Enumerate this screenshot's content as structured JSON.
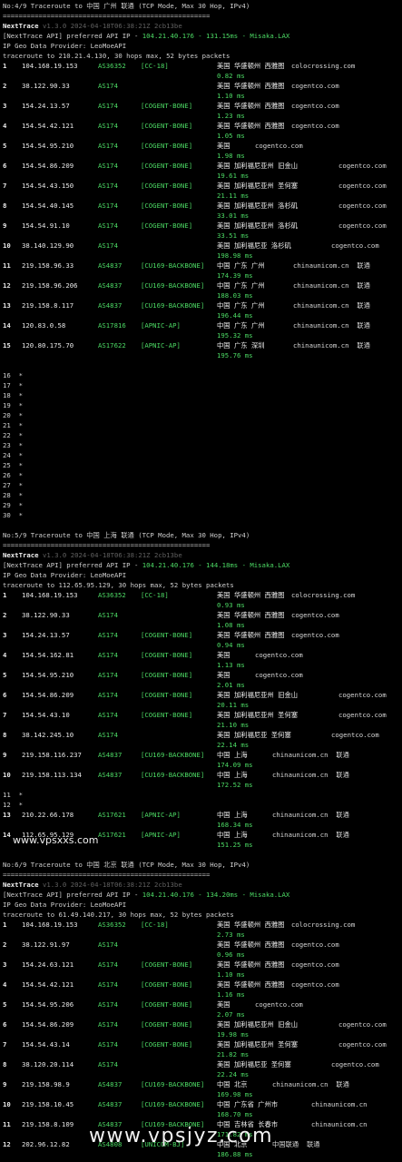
{
  "sections": [
    {
      "header": "No:4/9 Traceroute to 中国 广州 联通 (TCP Mode, Max 30 Hop, IPv4)",
      "separator": "====================================================",
      "app_name": "NextTrace",
      "version": "v1.3.0 2024-04-18T06:38:21Z 2cb13be",
      "api_prefix": "[NextTrace API] preferred API IP - ",
      "api_value": "104.21.40.176 - 131.15ms - Misaka.LAX",
      "geo_provider": "IP Geo Data Provider: LeoMoeAPI",
      "traceroute": "traceroute to 210.21.4.130, 30 hops max, 52 bytes packets",
      "hops": [
        {
          "n": "1",
          "ip": "104.168.19.153",
          "asn": "AS36352",
          "tag": "[CC-18]",
          "geo": "美国 华盛顿州 西雅图",
          "host": "colocrossing.com",
          "rtt": "0.82 ms"
        },
        {
          "n": "2",
          "ip": "38.122.90.33",
          "asn": "AS174",
          "tag": "",
          "geo": "美国 华盛顿州 西雅图",
          "host": "cogentco.com",
          "rtt": "1.10 ms"
        },
        {
          "n": "3",
          "ip": "154.24.13.57",
          "asn": "AS174",
          "tag": "[COGENT-BONE]",
          "geo": "美国 华盛顿州 西雅图",
          "host": "cogentco.com",
          "rtt": "1.23 ms"
        },
        {
          "n": "4",
          "ip": "154.54.42.121",
          "asn": "AS174",
          "tag": "[COGENT-BONE]",
          "geo": "美国 华盛顿州 西雅图",
          "host": "cogentco.com",
          "rtt": "1.05 ms"
        },
        {
          "n": "5",
          "ip": "154.54.95.210",
          "asn": "AS174",
          "tag": "[COGENT-BONE]",
          "geo": "美国",
          "host": "cogentco.com",
          "rtt": "1.98 ms"
        },
        {
          "n": "6",
          "ip": "154.54.86.209",
          "asn": "AS174",
          "tag": "[COGENT-BONE]",
          "geo": "美国 加利福尼亚州 旧金山",
          "host": "cogentco.com",
          "rtt": "19.61 ms"
        },
        {
          "n": "7",
          "ip": "154.54.43.150",
          "asn": "AS174",
          "tag": "[COGENT-BONE]",
          "geo": "美国 加利福尼亚州 圣何塞",
          "host": "cogentco.com",
          "rtt": "21.11 ms"
        },
        {
          "n": "8",
          "ip": "154.54.40.145",
          "asn": "AS174",
          "tag": "[COGENT-BONE]",
          "geo": "美国 加利福尼亚州 洛杉矶",
          "host": "cogentco.com",
          "rtt": "33.01 ms"
        },
        {
          "n": "9",
          "ip": "154.54.91.10",
          "asn": "AS174",
          "tag": "[COGENT-BONE]",
          "geo": "美国 加利福尼亚州 洛杉矶",
          "host": "cogentco.com",
          "rtt": "33.51 ms"
        },
        {
          "n": "10",
          "ip": "38.140.129.90",
          "asn": "AS174",
          "tag": "",
          "geo": "美国 加利福尼亚 洛杉矶",
          "host": "cogentco.com",
          "rtt": "198.98 ms"
        },
        {
          "n": "11",
          "ip": "219.158.96.33",
          "asn": "AS4837",
          "tag": "[CU169-BACKBONE]",
          "geo": "中国 广东 广州",
          "host": "chinaunicom.cn  联通",
          "rtt": "174.39 ms"
        },
        {
          "n": "12",
          "ip": "219.158.96.206",
          "asn": "AS4837",
          "tag": "[CU169-BACKBONE]",
          "geo": "中国 广东 广州",
          "host": "chinaunicom.cn  联通",
          "rtt": "188.03 ms"
        },
        {
          "n": "13",
          "ip": "219.158.8.117",
          "asn": "AS4837",
          "tag": "[CU169-BACKBONE]",
          "geo": "中国 广东 广州",
          "host": "chinaunicom.cn  联通",
          "rtt": "196.44 ms"
        },
        {
          "n": "14",
          "ip": "120.83.0.58",
          "asn": "AS17816",
          "tag": "[APNIC-AP]",
          "geo": "中国 广东 广州",
          "host": "chinaunicom.cn  联通",
          "rtt": "195.32 ms"
        },
        {
          "n": "15",
          "ip": "120.80.175.70",
          "asn": "AS17622",
          "tag": "[APNIC-AP]",
          "geo": "中国 广东 深圳",
          "host": "chinaunicom.cn  联通",
          "rtt": "195.76 ms"
        }
      ],
      "stars": [
        "16",
        "17",
        "18",
        "19",
        "20",
        "21",
        "22",
        "23",
        "24",
        "25",
        "26",
        "27",
        "28",
        "29",
        "30"
      ]
    },
    {
      "header": "No:5/9 Traceroute to 中国 上海 联通 (TCP Mode, Max 30 Hop, IPv4)",
      "separator": "====================================================",
      "app_name": "NextTrace",
      "version": "v1.3.0 2024-04-18T06:38:21Z 2cb13be",
      "api_prefix": "[NextTrace API] preferred API IP - ",
      "api_value": "104.21.40.176 - 144.18ms - Misaka.LAX",
      "geo_provider": "IP Geo Data Provider: LeoMoeAPI",
      "traceroute": "traceroute to 112.65.95.129, 30 hops max, 52 bytes packets",
      "hops": [
        {
          "n": "1",
          "ip": "104.168.19.153",
          "asn": "AS36352",
          "tag": "[CC-18]",
          "geo": "美国 华盛顿州 西雅图",
          "host": "colocrossing.com",
          "rtt": "0.93 ms"
        },
        {
          "n": "2",
          "ip": "38.122.90.33",
          "asn": "AS174",
          "tag": "",
          "geo": "美国 华盛顿州 西雅图",
          "host": "cogentco.com",
          "rtt": "1.08 ms"
        },
        {
          "n": "3",
          "ip": "154.24.13.57",
          "asn": "AS174",
          "tag": "[COGENT-BONE]",
          "geo": "美国 华盛顿州 西雅图",
          "host": "cogentco.com",
          "rtt": "0.94 ms"
        },
        {
          "n": "4",
          "ip": "154.54.162.81",
          "asn": "AS174",
          "tag": "[COGENT-BONE]",
          "geo": "美国",
          "host": "cogentco.com",
          "rtt": "1.13 ms"
        },
        {
          "n": "5",
          "ip": "154.54.95.210",
          "asn": "AS174",
          "tag": "[COGENT-BONE]",
          "geo": "美国",
          "host": "cogentco.com",
          "rtt": "2.01 ms"
        },
        {
          "n": "6",
          "ip": "154.54.86.209",
          "asn": "AS174",
          "tag": "[COGENT-BONE]",
          "geo": "美国 加利福尼亚州 旧金山",
          "host": "cogentco.com",
          "rtt": "20.11 ms"
        },
        {
          "n": "7",
          "ip": "154.54.43.10",
          "asn": "AS174",
          "tag": "[COGENT-BONE]",
          "geo": "美国 加利福尼亚州 圣何塞",
          "host": "cogentco.com",
          "rtt": "21.10 ms"
        },
        {
          "n": "8",
          "ip": "38.142.245.10",
          "asn": "AS174",
          "tag": "",
          "geo": "美国 加利福尼亚 圣何塞",
          "host": "cogentco.com",
          "rtt": "22.14 ms"
        },
        {
          "n": "9",
          "ip": "219.158.116.237",
          "asn": "AS4837",
          "tag": "[CU169-BACKBONE]",
          "geo": "中国 上海",
          "host": "chinaunicom.cn  联通",
          "rtt": "174.09 ms"
        },
        {
          "n": "10",
          "ip": "219.158.113.134",
          "asn": "AS4837",
          "tag": "[CU169-BACKBONE]",
          "geo": "中国 上海",
          "host": "chinaunicom.cn  联通",
          "rtt": "172.52 ms"
        }
      ],
      "stars": [
        "11",
        "12"
      ],
      "hops_after": [
        {
          "n": "13",
          "ip": "210.22.66.178",
          "asn": "AS17621",
          "tag": "[APNIC-AP]",
          "geo": "中国 上海",
          "host": "chinaunicom.cn  联通",
          "rtt": "168.34 ms"
        },
        {
          "n": "14",
          "ip": "112.65.95.129",
          "asn": "AS17621",
          "tag": "[APNIC-AP]",
          "geo": "中国 上海",
          "host": "chinaunicom.cn  联通",
          "rtt": "151.25 ms"
        }
      ]
    },
    {
      "header": "No:6/9 Traceroute to 中国 北京 联通 (TCP Mode, Max 30 Hop, IPv4)",
      "separator": "====================================================",
      "app_name": "NextTrace",
      "version": "v1.3.0 2024-04-18T06:38:21Z 2cb13be",
      "api_prefix": "[NextTrace API] preferred API IP - ",
      "api_value": "104.21.40.176 - 134.20ms - Misaka.LAX",
      "geo_provider": "IP Geo Data Provider: LeoMoeAPI",
      "traceroute": "traceroute to 61.49.140.217, 30 hops max, 52 bytes packets",
      "hops": [
        {
          "n": "1",
          "ip": "104.168.19.153",
          "asn": "AS36352",
          "tag": "[CC-18]",
          "geo": "美国 华盛顿州 西雅图",
          "host": "colocrossing.com",
          "rtt": "2.73 ms"
        },
        {
          "n": "2",
          "ip": "38.122.91.97",
          "asn": "AS174",
          "tag": "",
          "geo": "美国 华盛顿州 西雅图",
          "host": "cogentco.com",
          "rtt": "0.96 ms"
        },
        {
          "n": "3",
          "ip": "154.24.63.121",
          "asn": "AS174",
          "tag": "[COGENT-BONE]",
          "geo": "美国 华盛顿州 西雅图",
          "host": "cogentco.com",
          "rtt": "1.10 ms"
        },
        {
          "n": "4",
          "ip": "154.54.42.121",
          "asn": "AS174",
          "tag": "[COGENT-BONE]",
          "geo": "美国 华盛顿州 西雅图",
          "host": "cogentco.com",
          "rtt": "1.16 ms"
        },
        {
          "n": "5",
          "ip": "154.54.95.206",
          "asn": "AS174",
          "tag": "[COGENT-BONE]",
          "geo": "美国",
          "host": "cogentco.com",
          "rtt": "2.07 ms"
        },
        {
          "n": "6",
          "ip": "154.54.86.209",
          "asn": "AS174",
          "tag": "[COGENT-BONE]",
          "geo": "美国 加利福尼亚州 旧金山",
          "host": "cogentco.com",
          "rtt": "19.98 ms"
        },
        {
          "n": "7",
          "ip": "154.54.43.14",
          "asn": "AS174",
          "tag": "[COGENT-BONE]",
          "geo": "美国 加利福尼亚州 圣何塞",
          "host": "cogentco.com",
          "rtt": "21.82 ms"
        },
        {
          "n": "8",
          "ip": "38.120.20.114",
          "asn": "AS174",
          "tag": "",
          "geo": "美国 加利福尼亚 圣何塞",
          "host": "cogentco.com",
          "rtt": "22.24 ms"
        },
        {
          "n": "9",
          "ip": "219.158.98.9",
          "asn": "AS4837",
          "tag": "[CU169-BACKBONE]",
          "geo": "中国 北京",
          "host": "chinaunicom.cn  联通",
          "rtt": "169.98 ms"
        },
        {
          "n": "10",
          "ip": "219.158.10.45",
          "asn": "AS4837",
          "tag": "[CU169-BACKBONE]",
          "geo": "中国 广东省 广州市",
          "host": "chinaunicom.cn",
          "rtt": "168.70 ms"
        },
        {
          "n": "11",
          "ip": "219.158.8.109",
          "asn": "AS4837",
          "tag": "[CU169-BACKBONE]",
          "geo": "中国 吉林省 长春市",
          "host": "chinaunicom.cn",
          "rtt": "171.82 ms"
        },
        {
          "n": "12",
          "ip": "202.96.12.82",
          "asn": "AS4808",
          "tag": "[UNICOM-BJ]",
          "geo": "中国 北京",
          "host": "中国联通  联通",
          "rtt": "186.88 ms"
        }
      ]
    }
  ],
  "watermark_small": "www.vpsxxs.com",
  "watermark_large": "www.vpsjyz.com"
}
